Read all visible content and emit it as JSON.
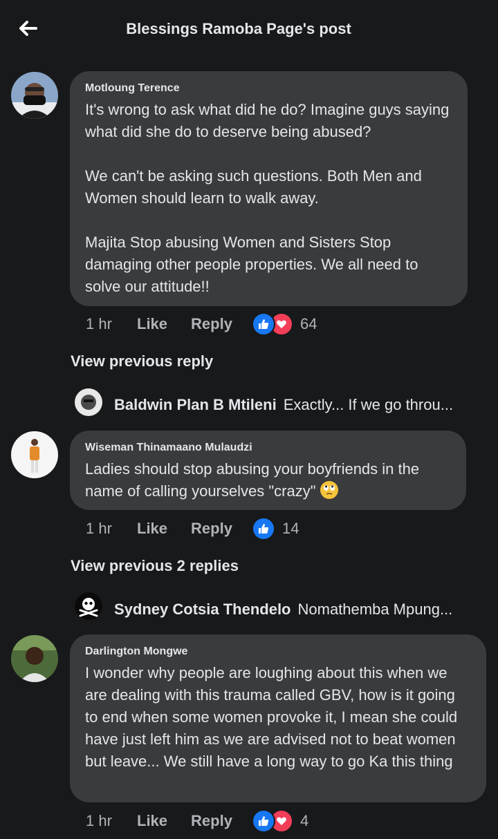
{
  "header": {
    "title": "Blessings Ramoba Page's post",
    "back_icon": "arrow-left-icon"
  },
  "comments": [
    {
      "author": "Motloung Terence",
      "text": "It's wrong to ask what did he do? Imagine guys saying what did she do to deserve being abused?\n\nWe can't be asking such questions. Both Men and Women should learn to walk away.\n\nMajita Stop abusing Women and Sisters Stop damaging other people properties. We all need to solve our attitude!!",
      "time": "1 hr",
      "like_label": "Like",
      "reply_label": "Reply",
      "reactions": [
        "like",
        "love"
      ],
      "reaction_count": "64",
      "view_previous": "View previous reply",
      "reply_preview": {
        "name": "Baldwin Plan B Mtileni",
        "text": "Exactly... If we go throu..."
      }
    },
    {
      "author": "Wiseman Thinamaano Mulaudzi",
      "text": "Ladies should stop abusing your boyfriends in the name of calling yourselves \"crazy\"",
      "emoji": "face-with-rolling-eyes",
      "time": "1 hr",
      "like_label": "Like",
      "reply_label": "Reply",
      "reactions": [
        "like"
      ],
      "reaction_count": "14",
      "view_previous": "View previous 2 replies",
      "reply_preview": {
        "name": "Sydney Cotsia Thendelo",
        "text": "Nomathemba Mpung..."
      }
    },
    {
      "author": "Darlington Mongwe",
      "text": "I wonder why people are loughing about this when we are dealing with this trauma called GBV, how is it going to end when some women provoke it, I mean she could have just left him as we are advised not to beat women but leave... We still have a long way to go Ka this thing",
      "time": "1 hr",
      "like_label": "Like",
      "reply_label": "Reply",
      "reactions": [
        "like",
        "love"
      ],
      "reaction_count": "4"
    }
  ],
  "colors": {
    "background": "#18191a",
    "bubble": "#3a3b3c",
    "text_primary": "#e4e6eb",
    "text_secondary": "#b0b3b8",
    "like_blue": "#1877f2",
    "love_red": "#f33e58"
  }
}
